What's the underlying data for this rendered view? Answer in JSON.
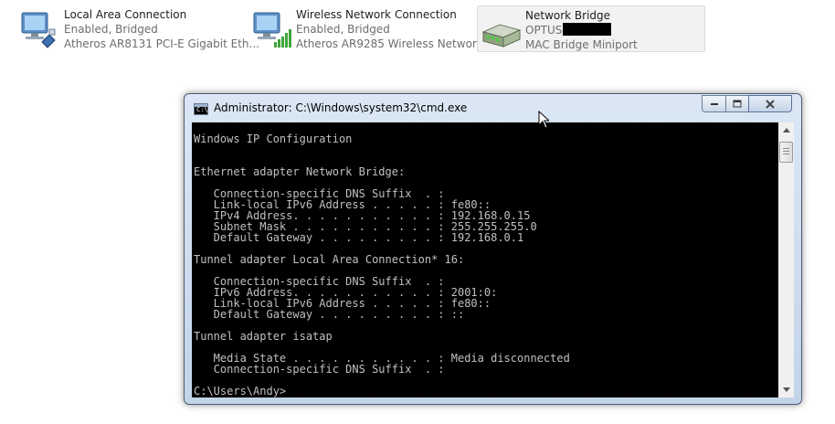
{
  "connections": [
    {
      "name": "Local Area Connection",
      "status": "Enabled, Bridged",
      "device": "Atheros AR8131 PCI-E Gigabit Eth...",
      "icon": "computer-network-icon"
    },
    {
      "name": "Wireless Network Connection",
      "status": "Enabled, Bridged",
      "device": "Atheros AR9285 Wireless Network...",
      "icon": "computer-wireless-icon"
    },
    {
      "name": "Network Bridge",
      "status": "OPTUS",
      "device": "MAC Bridge Miniport",
      "icon": "network-bridge-icon",
      "selected": true
    }
  ],
  "cmd_window": {
    "title": "Administrator: C:\\Windows\\system32\\cmd.exe",
    "icon_glyph": "C:\\",
    "buttons": {
      "minimize": "minimize",
      "maximize": "maximize",
      "close": "close"
    },
    "lines": [
      "",
      "Windows IP Configuration",
      "",
      "",
      "Ethernet adapter Network Bridge:",
      "",
      "   Connection-specific DNS Suffix  . :",
      "   Link-local IPv6 Address . . . . . : fe80::",
      "   IPv4 Address. . . . . . . . . . . : 192.168.0.15",
      "   Subnet Mask . . . . . . . . . . . : 255.255.255.0",
      "   Default Gateway . . . . . . . . . : 192.168.0.1",
      "",
      "Tunnel adapter Local Area Connection* 16:",
      "",
      "   Connection-specific DNS Suffix  . :",
      "   IPv6 Address. . . . . . . . . . . : 2001:0:",
      "   Link-local IPv6 Address . . . . . : fe80::",
      "   Default Gateway . . . . . . . . . : ::",
      "",
      "Tunnel adapter isatap",
      "",
      "   Media State . . . . . . . . . . . : Media disconnected",
      "   Connection-specific DNS Suffix  . :",
      "",
      "C:\\Users\\Andy>"
    ]
  },
  "colors": {
    "console_bg": "#000000",
    "console_text": "#c0c0c0",
    "window_frame": "#c3d4e9"
  }
}
